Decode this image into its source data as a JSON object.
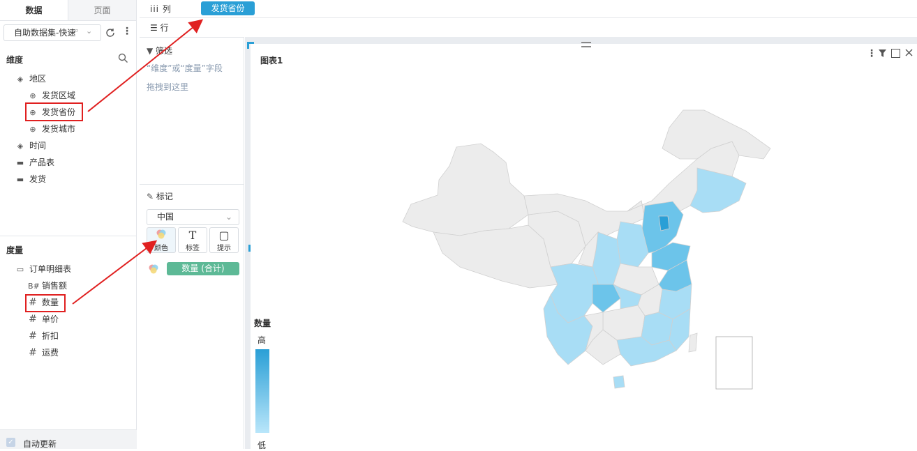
{
  "left_panel": {
    "tabs": [
      "数据",
      "页面"
    ],
    "dataset": "自助数据集-快速",
    "dimension_title": "维度",
    "dimensions": [
      {
        "label": "地区",
        "type": "layer"
      },
      {
        "label": "发货区域",
        "type": "geo"
      },
      {
        "label": "发货省份",
        "type": "geo"
      },
      {
        "label": "发货城市",
        "type": "geo"
      },
      {
        "label": "时间",
        "type": "layer"
      },
      {
        "label": "产品表",
        "type": "folder"
      },
      {
        "label": "发货",
        "type": "folder"
      }
    ],
    "measure_title": "度量",
    "measures": [
      {
        "label": "订单明细表",
        "type": "folder-open"
      },
      {
        "label": "销售额",
        "type": "calc"
      },
      {
        "label": "数量",
        "type": "num"
      },
      {
        "label": "单价",
        "type": "num"
      },
      {
        "label": "折扣",
        "type": "num"
      },
      {
        "label": "运费",
        "type": "num"
      }
    ],
    "auto_update": "自动更新"
  },
  "shelves": {
    "col_label": "列",
    "col_field": "发货省份",
    "row_label": "行"
  },
  "filter": {
    "title": "筛选",
    "hint_line1": "“维度”或“度量”字段",
    "hint_line2": "拖拽到这里"
  },
  "marks": {
    "title": "标记",
    "mark_type": "中国",
    "buttons": [
      "颜色",
      "标签",
      "提示"
    ],
    "color_field": "数量 (合计)"
  },
  "chart": {
    "title": "图表1",
    "legend_title": "数量",
    "legend_high": "高",
    "legend_low": "低"
  },
  "colors": {
    "accent": "#2a9fd6",
    "green_pill": "#5db996",
    "annotation_red": "#e02020",
    "map_gray": "#ececec",
    "map_light": "#a8ddf5",
    "map_mid": "#6cc4ea",
    "map_dark": "#2a9fd6"
  }
}
